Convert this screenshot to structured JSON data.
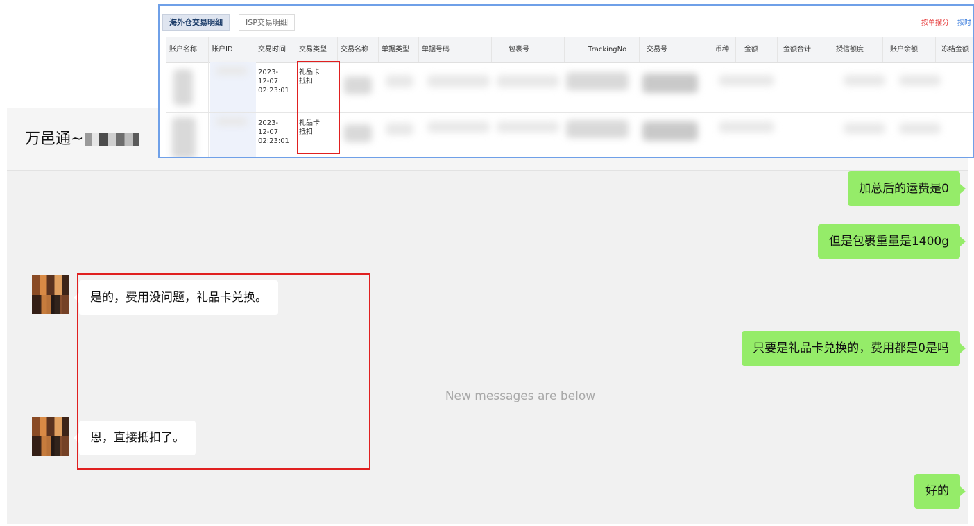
{
  "chat": {
    "title": "万邑通~",
    "divider_text": "New messages are below",
    "messages": [
      {
        "side": "me",
        "text": "加总后的运费是0"
      },
      {
        "side": "me",
        "text": "但是包裹重量是1400g"
      },
      {
        "side": "other",
        "text": "是的，费用没问题，礼品卡兑换。"
      },
      {
        "side": "me",
        "text": "只要是礼品卡兑换的，费用都是0是吗"
      },
      {
        "side": "other",
        "text": "恩，直接抵扣了。"
      },
      {
        "side": "me",
        "text": "好的"
      }
    ]
  },
  "table_panel": {
    "tabs": [
      {
        "label": "海外仓交易明细",
        "active": true
      },
      {
        "label": "ISP交易明细",
        "active": false
      }
    ],
    "top_links": [
      "按单摆分",
      "按时"
    ],
    "columns": [
      "账户名称",
      "账户ID",
      "交易时间",
      "交易类型",
      "交易名称",
      "单据类型",
      "单据号码",
      "包裹号",
      "TrackingNo",
      "交易号",
      "币种",
      "金额",
      "金额合计",
      "授信额度",
      "账户余额",
      "冻结金额"
    ],
    "rows": [
      {
        "time": [
          "2023-",
          "12-07",
          "02:23:01"
        ],
        "type": [
          "礼品卡",
          "抵扣"
        ]
      },
      {
        "time": [
          "2023-",
          "12-07",
          "02:23:01"
        ],
        "type": [
          "礼品卡",
          "抵扣"
        ]
      }
    ]
  },
  "colors": {
    "my_bubble": "#95ec69",
    "other_bubble": "#ffffff",
    "highlight": "#e02020",
    "panel_border": "#6fa0e8"
  }
}
